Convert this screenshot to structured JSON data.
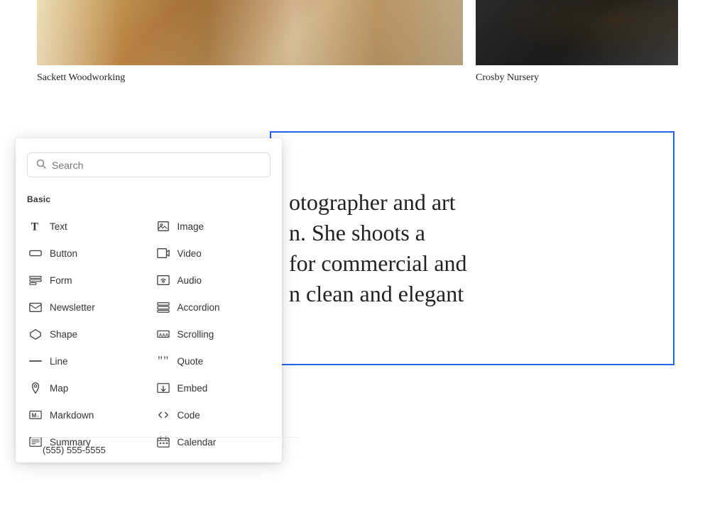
{
  "gallery": {
    "items": [
      {
        "label": "Sackett Woodworking",
        "type": "woodworking"
      },
      {
        "label": "Crosby Nursery",
        "type": "nursery"
      }
    ]
  },
  "panel": {
    "search": {
      "placeholder": "Search",
      "value": ""
    },
    "section_label": "Basic",
    "items_left": [
      {
        "id": "text",
        "label": "Text",
        "icon": "text"
      },
      {
        "id": "button",
        "label": "Button",
        "icon": "button"
      },
      {
        "id": "form",
        "label": "Form",
        "icon": "form"
      },
      {
        "id": "newsletter",
        "label": "Newsletter",
        "icon": "newsletter"
      },
      {
        "id": "shape",
        "label": "Shape",
        "icon": "shape"
      },
      {
        "id": "line",
        "label": "Line",
        "icon": "line"
      },
      {
        "id": "map",
        "label": "Map",
        "icon": "map"
      },
      {
        "id": "markdown",
        "label": "Markdown",
        "icon": "markdown"
      },
      {
        "id": "summary",
        "label": "Summary",
        "icon": "summary"
      }
    ],
    "items_right": [
      {
        "id": "image",
        "label": "Image",
        "icon": "image"
      },
      {
        "id": "video",
        "label": "Video",
        "icon": "video"
      },
      {
        "id": "audio",
        "label": "Audio",
        "icon": "audio"
      },
      {
        "id": "accordion",
        "label": "Accordion",
        "icon": "accordion"
      },
      {
        "id": "scrolling",
        "label": "Scrolling",
        "icon": "scrolling"
      },
      {
        "id": "quote",
        "label": "Quote",
        "icon": "quote"
      },
      {
        "id": "embed",
        "label": "Embed",
        "icon": "embed"
      },
      {
        "id": "code",
        "label": "Code",
        "icon": "code"
      },
      {
        "id": "calendar",
        "label": "Calendar",
        "icon": "calendar"
      }
    ],
    "phone": "(555) 555-5555"
  },
  "text_content": {
    "text": "otographer and art n. She shoots a for commercial and n clean and elegant"
  }
}
